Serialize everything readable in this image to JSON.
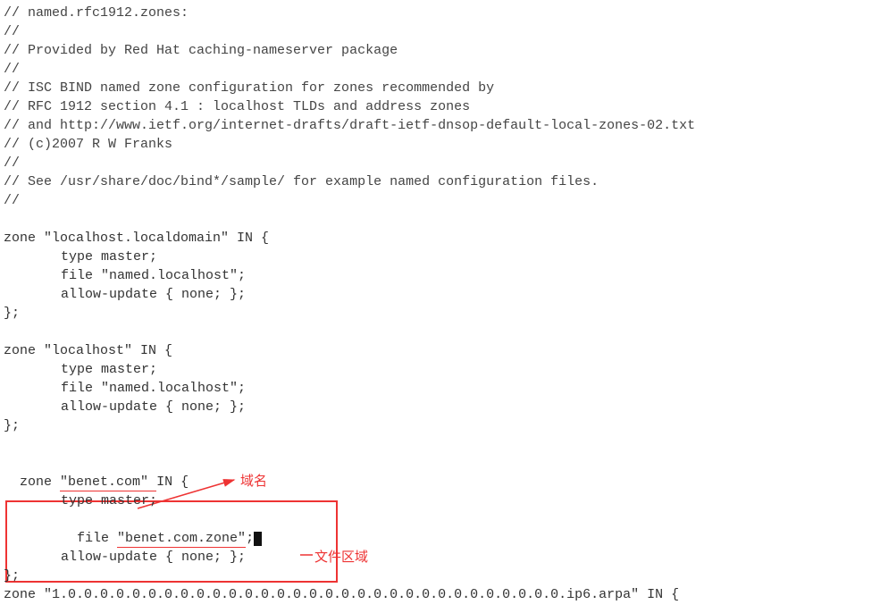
{
  "comments": {
    "c0": "// named.rfc1912.zones:",
    "c1": "//",
    "c2": "// Provided by Red Hat caching-nameserver package",
    "c3": "//",
    "c4": "// ISC BIND named zone configuration for zones recommended by",
    "c5": "// RFC 1912 section 4.1 : localhost TLDs and address zones",
    "c6": "// and http://www.ietf.org/internet-drafts/draft-ietf-dnsop-default-local-zones-02.txt",
    "c7": "// (c)2007 R W Franks",
    "c8": "//",
    "c9": "// See /usr/share/doc/bind*/sample/ for example named configuration files.",
    "c10": "//"
  },
  "zone1": {
    "open": "zone \"localhost.localdomain\" IN {",
    "l1": "type master;",
    "l2": "file \"named.localhost\";",
    "l3": "allow-update { none; };",
    "close": "};"
  },
  "zone2": {
    "open": "zone \"localhost\" IN {",
    "l1": "type master;",
    "l2": "file \"named.localhost\";",
    "l3": "allow-update { none; };",
    "close": "};"
  },
  "zone3": {
    "zone_kw": "zone ",
    "domain": "\"benet.com\" ",
    "after_domain": "IN {",
    "l1": "type master;",
    "file_kw": "file ",
    "file_val": "\"benet.com.zone\"",
    "file_end": ";",
    "l3": "allow-update { none; };",
    "close": "};"
  },
  "zone4": {
    "open": "zone \"1.0.0.0.0.0.0.0.0.0.0.0.0.0.0.0.0.0.0.0.0.0.0.0.0.0.0.0.0.0.0.0.ip6.arpa\" IN {"
  },
  "annot": {
    "domain_label": "域名",
    "file_label": "文件区域"
  }
}
